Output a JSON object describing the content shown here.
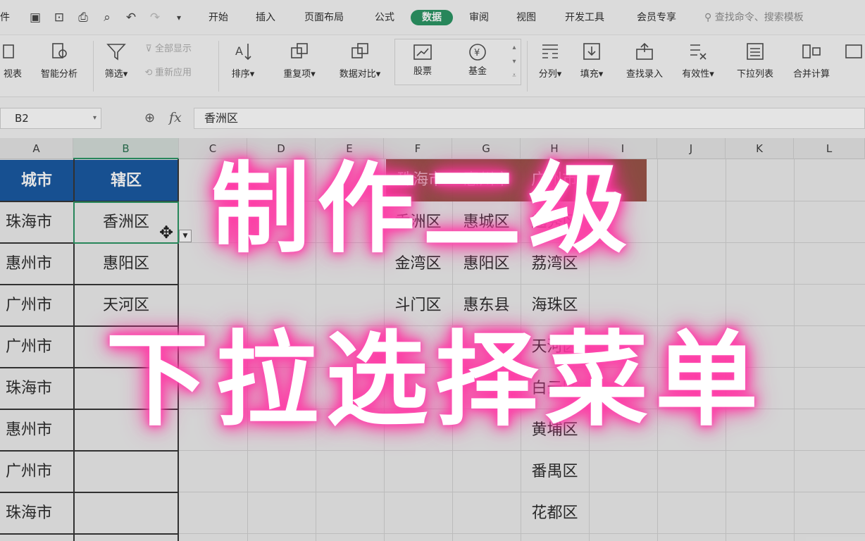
{
  "menubar": {
    "truncated_first": "件",
    "items": [
      "开始",
      "插入",
      "页面布局",
      "公式",
      "数据",
      "审阅",
      "视图",
      "开发工具",
      "会员专享"
    ],
    "active": "数据",
    "search_placeholder": "查找命令、搜索模板"
  },
  "ribbon": {
    "pivot_partial": "视表",
    "smart_analysis": "智能分析",
    "filter": "筛选",
    "show_all": "全部显示",
    "reapply": "重新应用",
    "sort": "排序",
    "duplicates": "重复项",
    "data_compare": "数据对比",
    "stocks": "股票",
    "funds": "基金",
    "split_column": "分列",
    "fill": "填充",
    "lookup_entry": "查找录入",
    "validity": "有效性",
    "dropdown_list": "下拉列表",
    "consolidate": "合并计算"
  },
  "formula_bar": {
    "name_box": "B2",
    "formula_value": "香洲区",
    "fx_label": "fx"
  },
  "grid": {
    "columns": [
      "A",
      "B",
      "C",
      "D",
      "E",
      "F",
      "G",
      "H",
      "I",
      "J",
      "K",
      "L"
    ],
    "selected_column": "B",
    "header_row": {
      "A": "城市",
      "B": "辖区"
    },
    "col_a": [
      "珠海市",
      "惠州市",
      "广州市",
      "广州市",
      "珠海市",
      "惠州市",
      "广州市",
      "珠海市"
    ],
    "col_b": [
      "香洲区",
      "惠阳区",
      "天河区"
    ],
    "col_f": [
      "香洲区",
      "金湾区",
      "斗门区"
    ],
    "col_g": [
      "惠城区",
      "惠阳区",
      "惠东县"
    ],
    "col_h": [
      "越秀区",
      "荔湾区",
      "海珠区",
      "天河区",
      "白云区",
      "黄埔区",
      "番禺区",
      "花都区"
    ],
    "top_header_fg": [
      "珠海市",
      "惠州市",
      "广州市"
    ]
  },
  "overlay": {
    "line1": "制作二级",
    "line2": "下拉选择菜单"
  },
  "colors": {
    "accent_green": "#1e8f5b",
    "header_blue": "#0b4f9c",
    "glow_pink": "#ff2f9e"
  }
}
